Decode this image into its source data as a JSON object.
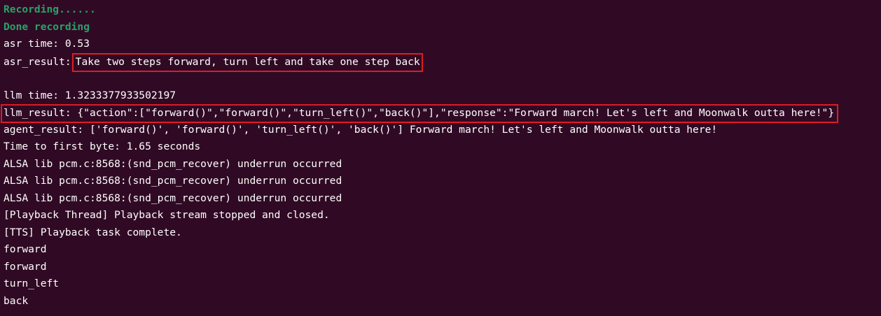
{
  "terminal": {
    "lines": {
      "l0": "Recording......",
      "l1": "Done recording",
      "l2": "asr time: 0.53",
      "l3_label": "asr_result:",
      "l3_value": "Take two steps forward, turn left and take one step back",
      "l4": "",
      "l5": "llm time: 1.3233377933502197",
      "l6": "llm_result: {\"action\":[\"forward()\",\"forward()\",\"turn_left()\",\"back()\"],\"response\":\"Forward march! Let's left and Moonwalk outta here!\"}",
      "l7": "agent_result: ['forward()', 'forward()', 'turn_left()', 'back()'] Forward march! Let's left and Moonwalk outta here!",
      "l8": "Time to first byte: 1.65 seconds",
      "l9": "ALSA lib pcm.c:8568:(snd_pcm_recover) underrun occurred",
      "l10": "ALSA lib pcm.c:8568:(snd_pcm_recover) underrun occurred",
      "l11": "ALSA lib pcm.c:8568:(snd_pcm_recover) underrun occurred",
      "l12": "[Playback Thread] Playback stream stopped and closed.",
      "l13": "[TTS] Playback task complete.",
      "l14": "forward",
      "l15": "forward",
      "l16": "turn_left",
      "l17": "back"
    }
  },
  "colors": {
    "background": "#300a24",
    "text": "#ffffff",
    "status_green": "#26a269",
    "highlight_box": "#e01b24"
  }
}
